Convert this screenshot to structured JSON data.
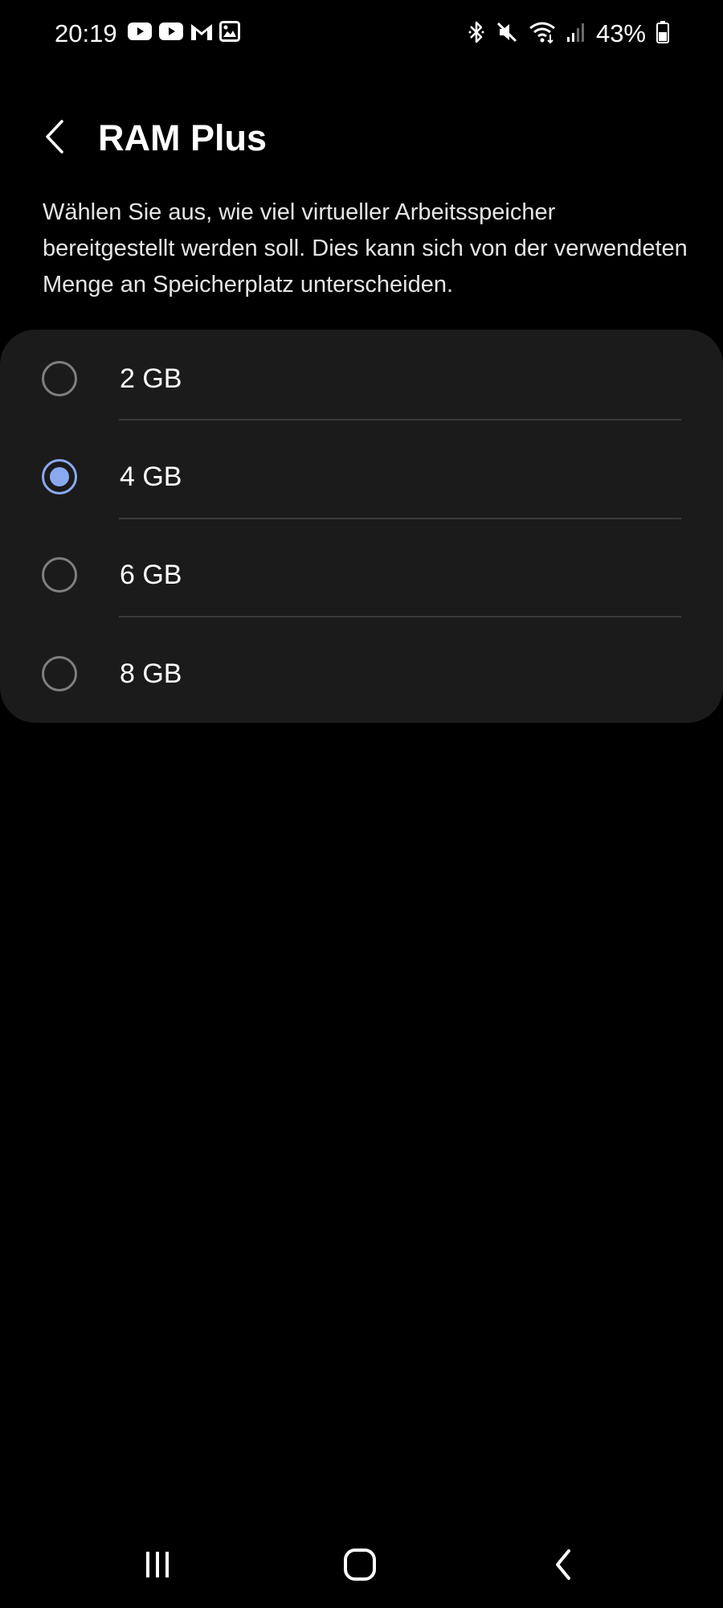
{
  "status_bar": {
    "time": "20:19",
    "notification_icons": [
      "youtube-icon",
      "youtube-icon",
      "gmail-icon",
      "gallery-icon"
    ],
    "system_icons": [
      "bluetooth-icon",
      "mute-icon",
      "wifi-icon",
      "signal-icon",
      "battery-icon"
    ],
    "battery_percent": "43%"
  },
  "header": {
    "back_icon": "back-arrow-icon",
    "title": "RAM Plus"
  },
  "description": "Wählen Sie aus, wie viel virtueller Arbeitsspeicher bereitgestellt werden soll. Dies kann sich von der verwendeten Menge an Speicherplatz unterscheiden.",
  "options": [
    {
      "label": "2 GB",
      "selected": false
    },
    {
      "label": "4 GB",
      "selected": true
    },
    {
      "label": "6 GB",
      "selected": false
    },
    {
      "label": "8 GB",
      "selected": false
    }
  ],
  "navigation": {
    "buttons": [
      "recent-apps-icon",
      "home-icon",
      "back-icon"
    ]
  },
  "colors": {
    "background": "#000000",
    "card": "#1b1b1b",
    "accent": "#8aaaf0",
    "divider": "#3a3a3a"
  }
}
